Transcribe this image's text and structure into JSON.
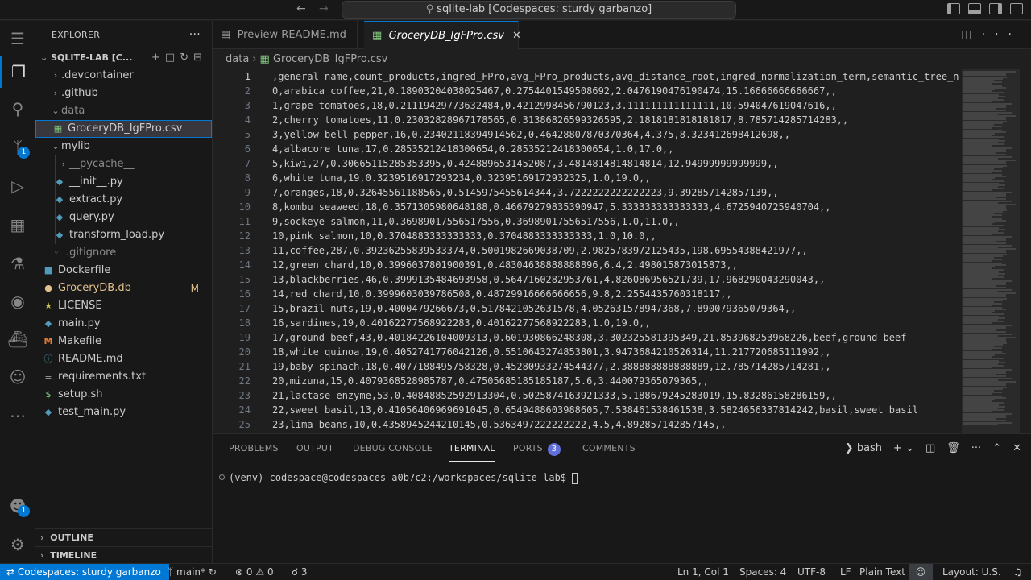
{
  "window": {
    "title": "sqlite-lab [Codespaces: sturdy garbanzo]"
  },
  "activity_bar": {
    "source_control_badge": "1",
    "accounts_badge": "1"
  },
  "explorer": {
    "header": "EXPLORER",
    "root_folder": "SQLITE-LAB [C...",
    "items": [
      {
        "label": ".devcontainer"
      },
      {
        "label": ".github"
      },
      {
        "label": "data"
      },
      {
        "label": "GroceryDB_IgFPro.csv"
      },
      {
        "label": "mylib"
      },
      {
        "label": "__pycache__"
      },
      {
        "label": "__init__.py"
      },
      {
        "label": "extract.py"
      },
      {
        "label": "query.py"
      },
      {
        "label": "transform_load.py"
      },
      {
        "label": ".gitignore"
      },
      {
        "label": "Dockerfile"
      },
      {
        "label": "GroceryDB.db",
        "badge": "M"
      },
      {
        "label": "LICENSE"
      },
      {
        "label": "main.py"
      },
      {
        "label": "Makefile"
      },
      {
        "label": "README.md"
      },
      {
        "label": "requirements.txt"
      },
      {
        "label": "setup.sh"
      },
      {
        "label": "test_main.py"
      }
    ],
    "outline": "OUTLINE",
    "timeline": "TIMELINE"
  },
  "tabs": [
    {
      "label": "Preview README.md"
    },
    {
      "label": "GroceryDB_IgFPro.csv"
    }
  ],
  "breadcrumbs": [
    "data",
    "GroceryDB_IgFPro.csv"
  ],
  "editor": {
    "lines": [
      {
        "n": "1",
        "text": ",general name,count_products,ingred_FPro,avg_FPro_products,avg_distance_root,ingred_normalization_term,semantic_tree_n"
      },
      {
        "n": "2",
        "text": "0,arabica coffee,21,0.18903204038025467,0.2754401549508692,2.0476190476190474,15.16666666666667,,"
      },
      {
        "n": "3",
        "text": "1,grape tomatoes,18,0.21119429773632484,0.4212998456790123,3.111111111111111,10.594047619047616,,"
      },
      {
        "n": "4",
        "text": "2,cherry tomatoes,11,0.23032828967178565,0.31386826599326595,2.1818181818181817,8.785714285714283,,"
      },
      {
        "n": "5",
        "text": "3,yellow bell pepper,16,0.23402118394914562,0.46428807870370364,4.375,8.323412698412698,,"
      },
      {
        "n": "6",
        "text": "4,albacore tuna,17,0.28535212418300654,0.28535212418300654,1.0,17.0,,"
      },
      {
        "n": "7",
        "text": "5,kiwi,27,0.30665115285353395,0.4248896531452087,3.4814814814814814,12.94999999999999,,"
      },
      {
        "n": "8",
        "text": "6,white tuna,19,0.3239516917293234,0.32395169172932325,1.0,19.0,,"
      },
      {
        "n": "9",
        "text": "7,oranges,18,0.32645561188565,0.5145975455614344,3.7222222222222223,9.392857142857139,,"
      },
      {
        "n": "10",
        "text": "8,kombu seaweed,18,0.3571305980648188,0.46679279835390947,5.333333333333333,4.6725940725940704,,"
      },
      {
        "n": "11",
        "text": "9,sockeye salmon,11,0.36989017556517556,0.36989017556517556,1.0,11.0,,"
      },
      {
        "n": "12",
        "text": "10,pink salmon,10,0.3704883333333333,0.3704883333333333,1.0,10.0,,"
      },
      {
        "n": "13",
        "text": "11,coffee,287,0.39236255839533374,0.5001982669038709,2.9825783972125435,198.69554388421977,,"
      },
      {
        "n": "14",
        "text": "12,green chard,10,0.3996037801900391,0.48304638888888896,6.4,2.498015873015873,,"
      },
      {
        "n": "15",
        "text": "13,blackberries,46,0.3999135484693958,0.5647160282953761,4.826086956521739,17.968290043290043,,"
      },
      {
        "n": "16",
        "text": "14,red chard,10,0.3999603039786508,0.48729916666666656,9.8,2.2554435760318117,,"
      },
      {
        "n": "17",
        "text": "15,brazil nuts,19,0.4000479266673,0.5178421052631578,4.052631578947368,7.890079365079364,,"
      },
      {
        "n": "18",
        "text": "16,sardines,19,0.40162277568922283,0.40162277568922283,1.0,19.0,,"
      },
      {
        "n": "19",
        "text": "17,ground beef,43,0.40184226104009313,0.601930866248308,3.302325581395349,21.853968253968226,beef,ground beef"
      },
      {
        "n": "20",
        "text": "18,white quinoa,19,0.4052741776042126,0.5510643274853801,3.9473684210526314,11.217720685111992,,"
      },
      {
        "n": "21",
        "text": "19,baby spinach,18,0.4077188495758328,0.45280933274544377,2.388888888888889,12.785714285714281,,"
      },
      {
        "n": "22",
        "text": "20,mizuna,15,0.4079368528985787,0.47505685185185187,5.6,3.440079365079365,,"
      },
      {
        "n": "23",
        "text": "21,lactase enzyme,53,0.40848852592913304,0.5025874163921333,5.188679245283019,15.83286158286159,,"
      },
      {
        "n": "24",
        "text": "22,sweet basil,13,0.41056406969691045,0.6549488603988605,7.538461538461538,3.5824656337814242,basil,sweet basil"
      },
      {
        "n": "25",
        "text": "23,lima beans,10,0.4358945244210145,0.5363497222222222,4.5,4.892857142857145,,"
      }
    ]
  },
  "panel": {
    "tabs": [
      {
        "label": "PROBLEMS"
      },
      {
        "label": "OUTPUT"
      },
      {
        "label": "DEBUG CONSOLE"
      },
      {
        "label": "TERMINAL"
      },
      {
        "label": "PORTS",
        "badge": "3"
      },
      {
        "label": "COMMENTS"
      }
    ],
    "shell": "bash",
    "terminal_prompt": "(venv) codespace@codespaces-a0b7c2:/workspaces/sqlite-lab$ "
  },
  "statusbar": {
    "remote": "Codespaces: sturdy garbanzo",
    "branch": "main*",
    "errors": "0",
    "warnings": "0",
    "ports": "3",
    "position": "Ln 1, Col 1",
    "spaces": "Spaces: 4",
    "encoding": "UTF-8",
    "eol": "LF",
    "language": "Plain Text",
    "layout": "Layout: U.S."
  },
  "colors": {
    "accent": "#0078d4",
    "background": "#1f1f1f",
    "sidebar": "#181818",
    "modified": "#e2c08d"
  }
}
